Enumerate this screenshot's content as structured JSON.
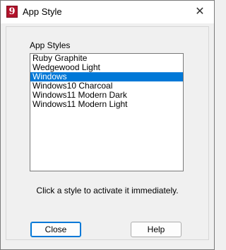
{
  "window": {
    "title": "App Style",
    "icon_glyph": "9",
    "icon_name": "app-logo-icon",
    "close_glyph": "✕"
  },
  "group": {
    "label": "App Styles",
    "items": [
      {
        "label": "Ruby Graphite",
        "selected": false
      },
      {
        "label": "Wedgewood Light",
        "selected": false
      },
      {
        "label": "Windows",
        "selected": true
      },
      {
        "label": "Windows10 Charcoal",
        "selected": false
      },
      {
        "label": "Windows11 Modern Dark",
        "selected": false
      },
      {
        "label": "Windows11 Modern Light",
        "selected": false
      }
    ],
    "hint": "Click a style to activate it immediately."
  },
  "buttons": {
    "close_label": "Close",
    "help_label": "Help"
  },
  "colors": {
    "selection": "#0078d7",
    "icon_bg": "#b2132b"
  }
}
